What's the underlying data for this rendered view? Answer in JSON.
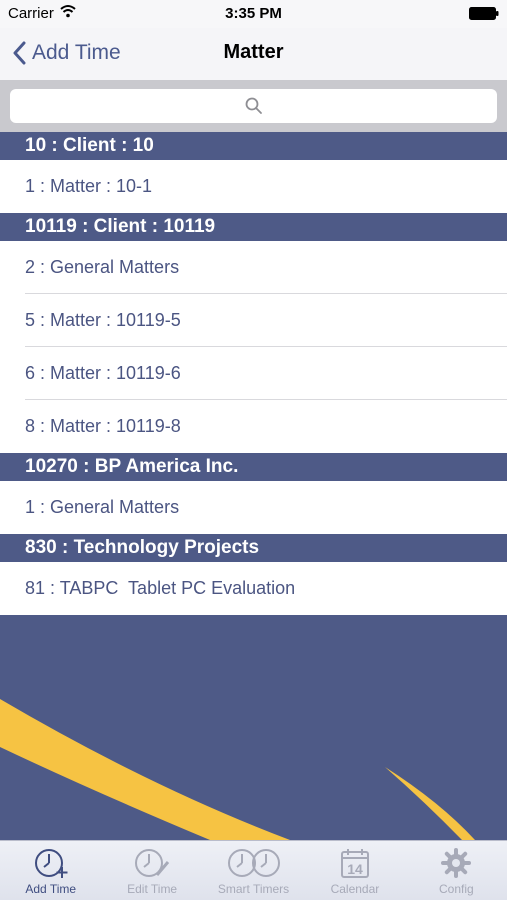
{
  "status_bar": {
    "carrier": "Carrier",
    "time": "3:35 PM"
  },
  "nav": {
    "back_label": "Add Time",
    "title": "Matter"
  },
  "search": {
    "placeholder": ""
  },
  "sections": [
    {
      "header": "10 : Client : 10",
      "rows": [
        "1 : Matter : 10-1"
      ]
    },
    {
      "header": "10119 : Client : 10119",
      "rows": [
        "2 : General Matters",
        "5 : Matter : 10119-5",
        "6 : Matter : 10119-6",
        "8 : Matter : 10119-8"
      ]
    },
    {
      "header": "10270 : BP America Inc.",
      "rows": [
        "1 : General Matters"
      ]
    },
    {
      "header": "830 : Technology Projects",
      "rows": [
        "81 : TABPC  Tablet PC Evaluation"
      ]
    }
  ],
  "tab_bar": {
    "tabs": [
      {
        "label": "Add Time",
        "icon": "add-time-clock-icon",
        "active": true
      },
      {
        "label": "Edit Time",
        "icon": "edit-time-clock-icon",
        "active": false
      },
      {
        "label": "Smart Timers",
        "icon": "smart-timers-icon",
        "active": false
      },
      {
        "label": "Calendar",
        "icon": "calendar-icon",
        "active": false,
        "badge": "14"
      },
      {
        "label": "Config",
        "icon": "gear-icon",
        "active": false
      }
    ]
  },
  "colors": {
    "accent": "#4e5a87",
    "swoosh": "#f6c343",
    "active_tab": "#3f4d80"
  }
}
